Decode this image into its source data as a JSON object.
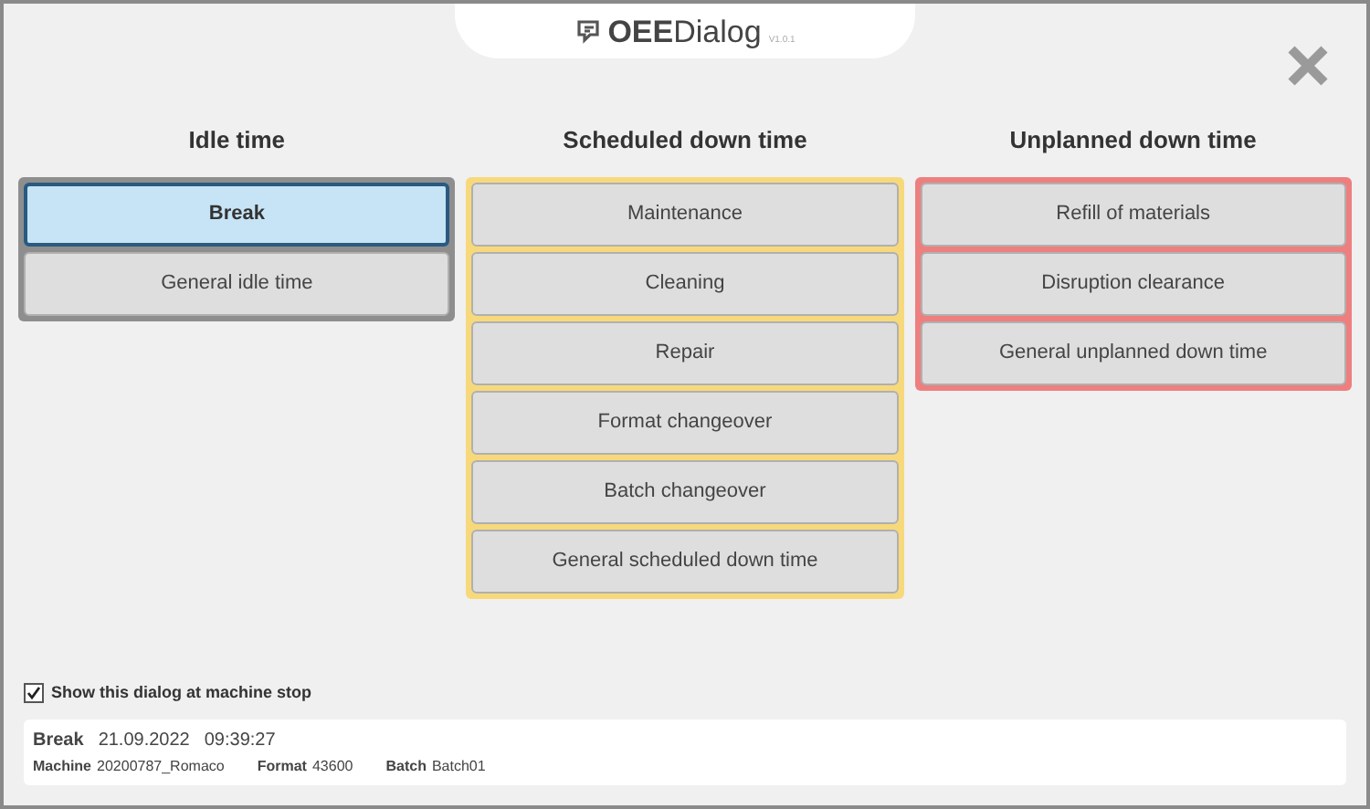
{
  "header": {
    "logo_bold": "OEE",
    "logo_light": "Dialog",
    "version": "V1.0.1"
  },
  "groups": [
    {
      "title": "Idle time",
      "color": "#8e8e8e",
      "items": [
        {
          "label": "Break",
          "selected": true
        },
        {
          "label": "General idle time",
          "selected": false
        }
      ]
    },
    {
      "title": "Scheduled down time",
      "color": "#f7d97c",
      "items": [
        {
          "label": "Maintenance",
          "selected": false
        },
        {
          "label": "Cleaning",
          "selected": false
        },
        {
          "label": "Repair",
          "selected": false
        },
        {
          "label": "Format changeover",
          "selected": false
        },
        {
          "label": "Batch changeover",
          "selected": false
        },
        {
          "label": "General scheduled down time",
          "selected": false
        }
      ]
    },
    {
      "title": "Unplanned down time",
      "color": "#ee7f7f",
      "items": [
        {
          "label": "Refill of materials",
          "selected": false
        },
        {
          "label": "Disruption clearance",
          "selected": false
        },
        {
          "label": "General unplanned down time",
          "selected": false
        }
      ]
    }
  ],
  "show_dialog": {
    "label": "Show this dialog at machine stop",
    "checked": true
  },
  "status": {
    "reason": "Break",
    "date": "21.09.2022",
    "time": "09:39:27",
    "fields": [
      {
        "label": "Machine",
        "value": "20200787_Romaco"
      },
      {
        "label": "Format",
        "value": "43600"
      },
      {
        "label": "Batch",
        "value": "Batch01"
      }
    ]
  }
}
